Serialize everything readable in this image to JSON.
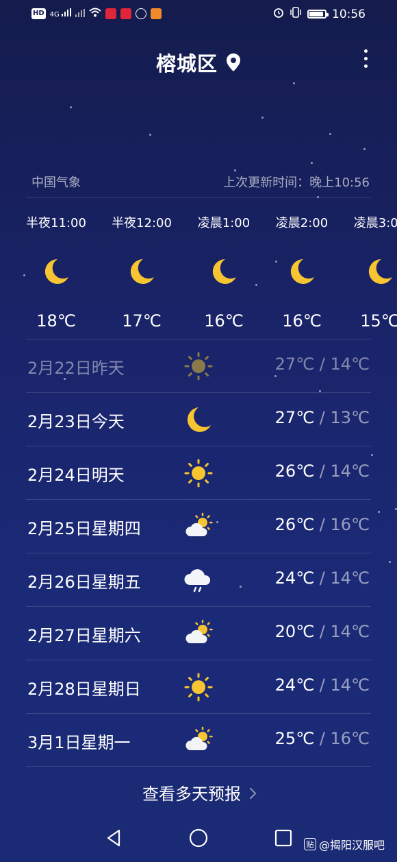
{
  "status_bar": {
    "left_chips": [
      "HD",
      "4G",
      "",
      "",
      "",
      "",
      "",
      ""
    ],
    "time": "10:56",
    "battery_percent": 85
  },
  "header": {
    "location": "榕城区"
  },
  "source": {
    "provider": "中国气象",
    "updated": "上次更新时间：晚上10:56"
  },
  "hourly": [
    {
      "time": "半夜11:00",
      "temp": "18℃",
      "icon": "moon-icon"
    },
    {
      "time": "半夜12:00",
      "temp": "17℃",
      "icon": "moon-icon"
    },
    {
      "time": "凌晨1:00",
      "temp": "16℃",
      "icon": "moon-icon"
    },
    {
      "time": "凌晨2:00",
      "temp": "16℃",
      "icon": "moon-icon"
    },
    {
      "time": "凌晨3:00",
      "temp": "15℃",
      "icon": "moon-icon"
    }
  ],
  "daily": [
    {
      "date": "2月22日昨天",
      "icon": "sun-icon-dim",
      "high": "27℃",
      "low": " / 14℃"
    },
    {
      "date": "2月23日今天",
      "icon": "moon-icon",
      "high": "27℃",
      "low": " / 13℃"
    },
    {
      "date": "2月24日明天",
      "icon": "sun-icon",
      "high": "26℃",
      "low": " / 14℃"
    },
    {
      "date": "2月25日星期四",
      "icon": "partly-cloudy-icon",
      "high": "26℃",
      "low": " / 16℃"
    },
    {
      "date": "2月26日星期五",
      "icon": "rain-cloud-icon",
      "high": "24℃",
      "low": " / 14℃"
    },
    {
      "date": "2月27日星期六",
      "icon": "partly-cloudy-icon",
      "high": "20℃",
      "low": " / 14℃"
    },
    {
      "date": "2月28日星期日",
      "icon": "sun-icon",
      "high": "24℃",
      "low": " / 14℃"
    },
    {
      "date": "3月1日星期一",
      "icon": "partly-cloudy-icon",
      "high": "25℃",
      "low": " / 16℃"
    }
  ],
  "more_forecast": "查看多天预报",
  "watermark": "@揭阳汉服吧",
  "colors": {
    "background_top": "#141c4d",
    "background_bottom": "#1a2a74",
    "icon_yellow": "#f7c531"
  }
}
